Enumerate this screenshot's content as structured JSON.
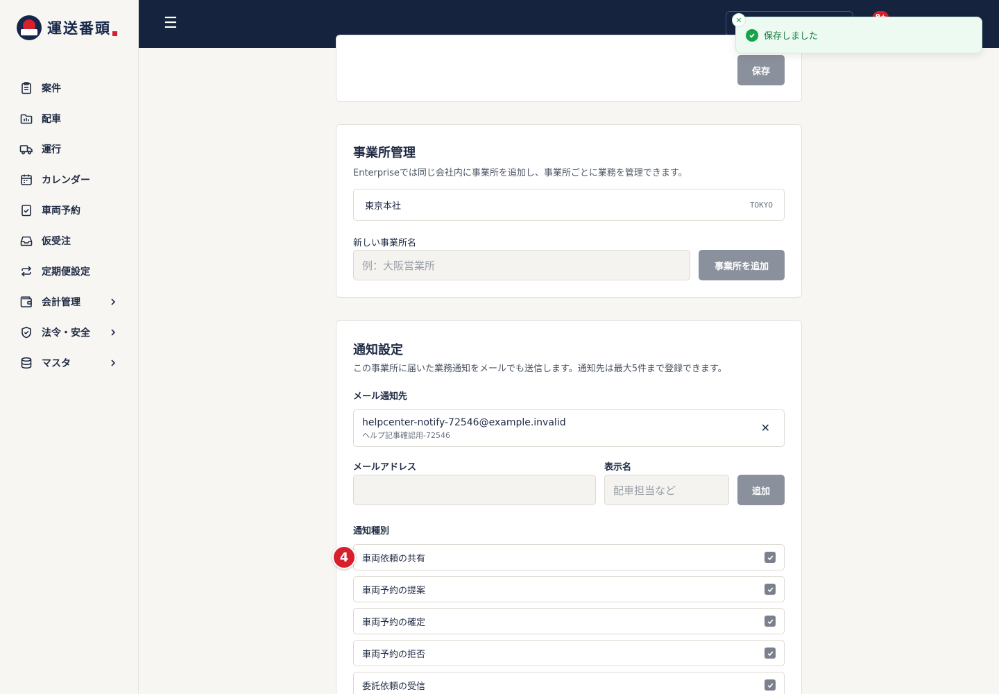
{
  "app": {
    "logo_text": "運送番頭",
    "brand_colors": {
      "navy": "#15233f",
      "red": "#d7202c"
    }
  },
  "sidebar": {
    "items": [
      {
        "label": "案件",
        "icon": "clipboard-icon"
      },
      {
        "label": "配車",
        "icon": "folder-chart-icon"
      },
      {
        "label": "運行",
        "icon": "truck-icon"
      },
      {
        "label": "カレンダー",
        "icon": "calendar-icon"
      },
      {
        "label": "車両予約",
        "icon": "clipboard-check-icon"
      },
      {
        "label": "仮受注",
        "icon": "inbox-icon"
      },
      {
        "label": "定期便設定",
        "icon": "repeat-icon"
      },
      {
        "label": "会計管理",
        "icon": "wallet-icon",
        "expandable": true
      },
      {
        "label": "法令・安全",
        "icon": "shield-check-icon",
        "expandable": true
      },
      {
        "label": "マスタ",
        "icon": "database-icon",
        "expandable": true
      }
    ]
  },
  "header": {
    "menu_icon": "hamburger-icon",
    "notification_count": "9+"
  },
  "toast": {
    "message": "保存しました",
    "icon": "check-circle-icon",
    "close_icon": "close-icon"
  },
  "top_card": {
    "save_label": "保存"
  },
  "office_card": {
    "title": "事業所管理",
    "description": "Enterpriseでは同じ会社内に事業所を追加し、事業所ごとに業務を管理できます。",
    "offices": [
      {
        "name": "東京本社",
        "code": "TOKYO"
      }
    ],
    "new_office_label": "新しい事業所名",
    "new_office_placeholder": "例：大阪営業所",
    "add_office_label": "事業所を追加"
  },
  "notification_card": {
    "title": "通知設定",
    "description": "この事業所に届いた業務通知をメールでも送信します。通知先は最大5件まで登録できます。",
    "recipients_label": "メール通知先",
    "recipients": [
      {
        "email": "helpcenter-notify-72546@example.invalid",
        "name": "ヘルプ記事確認用-72546"
      }
    ],
    "email_label": "メールアドレス",
    "email_placeholder": "",
    "display_name_label": "表示名",
    "display_name_placeholder": "配車担当など",
    "add_label": "追加",
    "types_label": "通知種別",
    "types": [
      {
        "label": "車両依頼の共有",
        "checked": true
      },
      {
        "label": "車両予約の提案",
        "checked": true
      },
      {
        "label": "車両予約の確定",
        "checked": true
      },
      {
        "label": "車両予約の拒否",
        "checked": true
      },
      {
        "label": "委託依頼の受信",
        "checked": true
      }
    ]
  },
  "step_marker": {
    "number": "4"
  }
}
